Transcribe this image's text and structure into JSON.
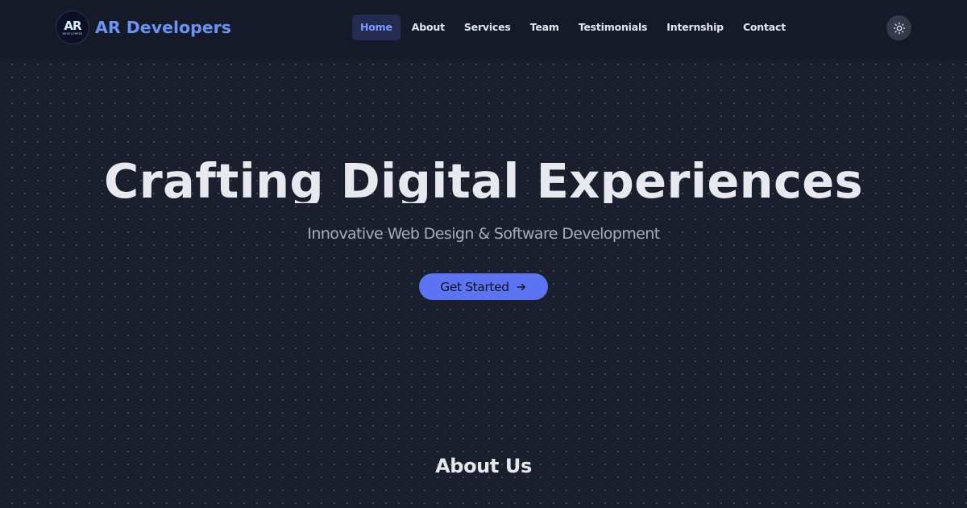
{
  "brand": {
    "logo_mark": "AR",
    "logo_sub": "DEVELOPERS",
    "name": "AR Developers"
  },
  "nav": {
    "items": [
      {
        "label": "Home",
        "active": true
      },
      {
        "label": "About",
        "active": false
      },
      {
        "label": "Services",
        "active": false
      },
      {
        "label": "Team",
        "active": false
      },
      {
        "label": "Testimonials",
        "active": false
      },
      {
        "label": "Internship",
        "active": false
      },
      {
        "label": "Contact",
        "active": false
      }
    ],
    "theme_toggle_icon": "sun-icon"
  },
  "hero": {
    "title": "Crafting Digital Experiences",
    "subtitle": "Innovative Web Design & Software Development",
    "cta_label": "Get Started",
    "cta_icon": "arrow-right-icon"
  },
  "about": {
    "heading": "About Us"
  },
  "colors": {
    "background": "#1a1f2e",
    "navbar": "#151a28",
    "accent": "#5c73f2",
    "brand_text": "#6b93f2",
    "active_nav_bg": "#232b51",
    "active_nav_text": "#7c9bff"
  }
}
